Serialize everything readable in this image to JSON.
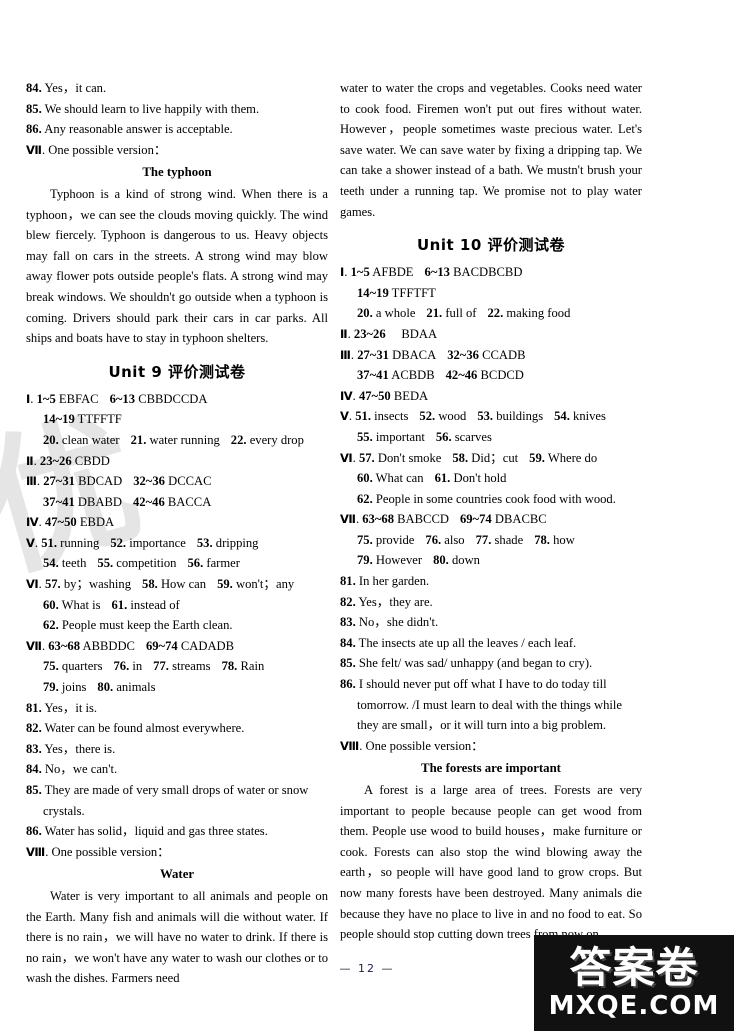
{
  "page": {
    "number": "— 12 —",
    "watermark_left": "优",
    "brand_cn": "答案卷",
    "brand_en": "MXQE.COM"
  },
  "left_column": {
    "top_answers": [
      {
        "num": "84.",
        "text": "Yes，it can."
      },
      {
        "num": "85.",
        "text": "We should learn to live happily with them."
      },
      {
        "num": "86.",
        "text": "Any reasonable answer is acceptable."
      }
    ],
    "version_line": {
      "roman": "Ⅶ",
      "text": ". One possible version："
    },
    "composition": {
      "title": "The typhoon",
      "paragraphs": [
        "Typhoon is a kind of strong wind. When there is a typhoon，we can see the clouds moving quickly. The wind blew fiercely. Typhoon is dangerous to us. Heavy objects may fall on cars in the streets. A strong wind may blow away flower pots outside people's flats. A strong wind may break windows. We shouldn't go outside when a typhoon is coming. Drivers should park their cars in car parks. All ships and boats have to stay in typhoon shelters."
      ]
    },
    "unit": {
      "label": "Unit 9",
      "cn": "评价测试卷"
    },
    "sections": [
      {
        "roman": "Ⅰ",
        "lines": [
          "1~5 EBFAC　6~13 CBBDCCDA",
          "14~19 TTFFTF",
          "20. clean water　21. water running　22. every drop"
        ],
        "parts": [
          {
            "indent": false,
            "items": [
              {
                "b": "1~5",
                "t": "EBFAC"
              },
              {
                "b": "6~13",
                "t": "CBBDCCDA"
              }
            ]
          },
          {
            "indent": true,
            "items": [
              {
                "b": "14~19",
                "t": "TTFFTF"
              }
            ]
          },
          {
            "indent": true,
            "items": [
              {
                "b": "20.",
                "t": "clean water"
              },
              {
                "b": "21.",
                "t": "water running"
              },
              {
                "b": "22.",
                "t": "every drop"
              }
            ]
          }
        ]
      },
      {
        "roman": "Ⅱ",
        "parts": [
          {
            "indent": false,
            "items": [
              {
                "b": "23~26",
                "t": "CBDD"
              }
            ]
          }
        ]
      },
      {
        "roman": "Ⅲ",
        "parts": [
          {
            "indent": false,
            "items": [
              {
                "b": "27~31",
                "t": "BDCAD"
              },
              {
                "b": "32~36",
                "t": "DCCAC"
              }
            ]
          },
          {
            "indent": true,
            "items": [
              {
                "b": "37~41",
                "t": "DBABD"
              },
              {
                "b": "42~46",
                "t": "BACCA"
              }
            ]
          }
        ]
      },
      {
        "roman": "Ⅳ",
        "parts": [
          {
            "indent": false,
            "items": [
              {
                "b": "47~50",
                "t": "EBDA"
              }
            ]
          }
        ]
      },
      {
        "roman": "Ⅴ",
        "parts": [
          {
            "indent": false,
            "items": [
              {
                "b": "51.",
                "t": "running"
              },
              {
                "b": "52.",
                "t": "importance"
              },
              {
                "b": "53.",
                "t": "dripping"
              }
            ]
          },
          {
            "indent": true,
            "items": [
              {
                "b": "54.",
                "t": "teeth"
              },
              {
                "b": "55.",
                "t": "competition"
              },
              {
                "b": "56.",
                "t": "farmer"
              }
            ]
          }
        ]
      },
      {
        "roman": "Ⅵ",
        "parts": [
          {
            "indent": false,
            "items": [
              {
                "b": "57.",
                "t": "by；washing"
              },
              {
                "b": "58.",
                "t": "How can"
              },
              {
                "b": "59.",
                "t": "won't；any"
              }
            ]
          },
          {
            "indent": true,
            "items": [
              {
                "b": "60.",
                "t": "What is"
              },
              {
                "b": "61.",
                "t": "instead of"
              }
            ]
          },
          {
            "indent": true,
            "items": [
              {
                "b": "62.",
                "t": "People must keep the Earth clean."
              }
            ]
          }
        ]
      },
      {
        "roman": "Ⅶ",
        "parts": [
          {
            "indent": false,
            "items": [
              {
                "b": "63~68",
                "t": "ABBDDC"
              },
              {
                "b": "69~74",
                "t": "CADADB"
              }
            ]
          },
          {
            "indent": true,
            "items": [
              {
                "b": "75.",
                "t": "quarters"
              },
              {
                "b": "76.",
                "t": "in"
              },
              {
                "b": "77.",
                "t": "streams"
              },
              {
                "b": "78.",
                "t": "Rain"
              }
            ]
          },
          {
            "indent": true,
            "items": [
              {
                "b": "79.",
                "t": "joins"
              },
              {
                "b": "80.",
                "t": "animals"
              }
            ]
          }
        ]
      }
    ],
    "long_answers": [
      {
        "num": "81.",
        "text": "Yes，it is."
      },
      {
        "num": "82.",
        "text": "Water can be found almost everywhere."
      },
      {
        "num": "83.",
        "text": "Yes，there is."
      },
      {
        "num": "84.",
        "text": "No，we can't."
      },
      {
        "num": "85.",
        "text": "They are made of very small drops of water or snow crystals."
      },
      {
        "num": "86.",
        "text": "Water has solid，liquid and gas three states."
      }
    ],
    "version_line2": {
      "roman": "Ⅷ",
      "text": ". One possible version："
    },
    "composition2": {
      "title": "Water",
      "text": "Water is very important to all animals and people on the Earth. Many fish and animals will die without water. If there is no rain，we will have no water to drink. If there is no rain，we won't have any water to wash our clothes or to wash the dishes. Farmers need"
    }
  },
  "right_column": {
    "continuation": "water to water the crops and vegetables. Cooks need water to cook food. Firemen won't put out fires without water. However，people sometimes waste precious water. Let's save water. We can save water by fixing a dripping tap. We can take a shower instead of a bath. We mustn't brush your teeth under a running tap. We promise not to play water games.",
    "unit": {
      "label": "Unit 10",
      "cn": "评价测试卷"
    },
    "sections": [
      {
        "roman": "Ⅰ",
        "parts": [
          {
            "indent": false,
            "items": [
              {
                "b": "1~5",
                "t": "AFBDE"
              },
              {
                "b": "6~13",
                "t": "BACDBCBD"
              }
            ]
          },
          {
            "indent": true,
            "items": [
              {
                "b": "14~19",
                "t": "TFFTFT"
              }
            ]
          },
          {
            "indent": true,
            "items": [
              {
                "b": "20.",
                "t": "a whole"
              },
              {
                "b": "21.",
                "t": "full of"
              },
              {
                "b": "22.",
                "t": "making food"
              }
            ]
          }
        ]
      },
      {
        "roman": "Ⅱ",
        "parts": [
          {
            "indent": false,
            "items": [
              {
                "b": "23~26",
                "t": "　BDAA"
              }
            ]
          }
        ]
      },
      {
        "roman": "Ⅲ",
        "parts": [
          {
            "indent": false,
            "items": [
              {
                "b": "27~31",
                "t": "DBACA"
              },
              {
                "b": "32~36",
                "t": "CCADB"
              }
            ]
          },
          {
            "indent": true,
            "items": [
              {
                "b": "37~41",
                "t": "ACBDB"
              },
              {
                "b": "42~46",
                "t": "BCDCD"
              }
            ]
          }
        ]
      },
      {
        "roman": "Ⅳ",
        "parts": [
          {
            "indent": false,
            "items": [
              {
                "b": "47~50",
                "t": "BEDA"
              }
            ]
          }
        ]
      },
      {
        "roman": "Ⅴ",
        "parts": [
          {
            "indent": false,
            "items": [
              {
                "b": "51.",
                "t": "insects"
              },
              {
                "b": "52.",
                "t": "wood"
              },
              {
                "b": "53.",
                "t": "buildings"
              },
              {
                "b": "54.",
                "t": "knives"
              }
            ]
          },
          {
            "indent": true,
            "items": [
              {
                "b": "55.",
                "t": "important"
              },
              {
                "b": "56.",
                "t": "scarves"
              }
            ]
          }
        ]
      },
      {
        "roman": "Ⅵ",
        "parts": [
          {
            "indent": false,
            "items": [
              {
                "b": "57.",
                "t": "Don't smoke"
              },
              {
                "b": "58.",
                "t": "Did；cut"
              },
              {
                "b": "59.",
                "t": "Where do"
              }
            ]
          },
          {
            "indent": true,
            "items": [
              {
                "b": "60.",
                "t": "What can"
              },
              {
                "b": "61.",
                "t": "Don't hold"
              }
            ]
          },
          {
            "indent": true,
            "items": [
              {
                "b": "62.",
                "t": "People in some countries cook food with wood."
              }
            ]
          }
        ]
      },
      {
        "roman": "Ⅶ",
        "parts": [
          {
            "indent": false,
            "items": [
              {
                "b": "63~68",
                "t": "BABCCD"
              },
              {
                "b": "69~74",
                "t": "DBACBC"
              }
            ]
          },
          {
            "indent": true,
            "items": [
              {
                "b": "75.",
                "t": "provide"
              },
              {
                "b": "76.",
                "t": "also"
              },
              {
                "b": "77.",
                "t": "shade"
              },
              {
                "b": "78.",
                "t": "how"
              }
            ]
          },
          {
            "indent": true,
            "items": [
              {
                "b": "79.",
                "t": "However"
              },
              {
                "b": "80.",
                "t": "down"
              }
            ]
          }
        ]
      }
    ],
    "long_answers": [
      {
        "num": "81.",
        "text": "In her garden."
      },
      {
        "num": "82.",
        "text": "Yes，they are."
      },
      {
        "num": "83.",
        "text": "No，she didn't."
      },
      {
        "num": "84.",
        "text": "The insects ate up all the leaves / each leaf."
      },
      {
        "num": "85.",
        "text": "She felt/ was sad/ unhappy (and began to cry)."
      },
      {
        "num": "86.",
        "text": "I should never put off what I have to do today till tomorrow. /I must learn to deal with the things while they are small，or it will turn into a big problem."
      }
    ],
    "version_line": {
      "roman": "Ⅷ",
      "text": ". One possible version："
    },
    "composition": {
      "title": "The forests are important",
      "text": "A forest is a large area of trees. Forests are very important to people because people can get wood from them. People use wood to build houses，make furniture or cook. Forests can also stop the wind blowing away the earth，so people will have good land to grow crops. But now many forests have been destroyed. Many animals die because they have no place to live in and no food to eat. So people should stop cutting down trees from now on."
    }
  }
}
